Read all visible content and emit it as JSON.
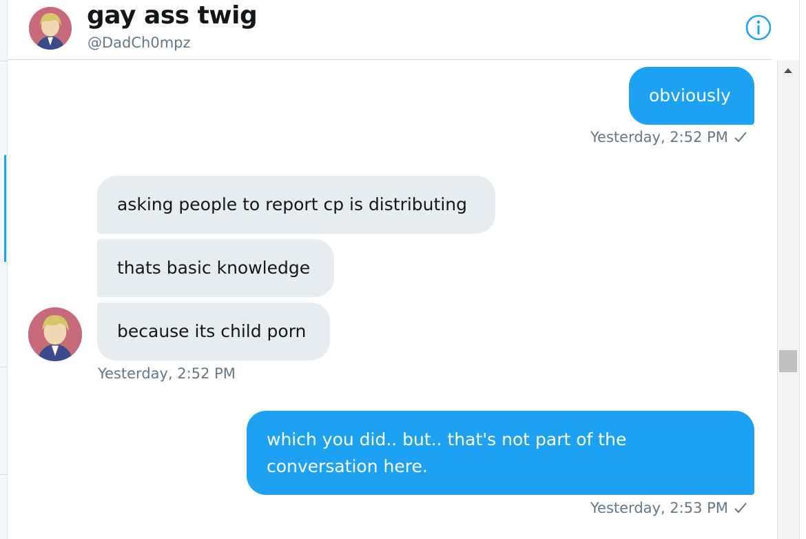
{
  "conversation": {
    "display_name": "gay ass twig",
    "handle": "@DadCh0mpz"
  },
  "icons": {
    "info": "info-circle-icon",
    "read_receipt": "checkmark-icon",
    "scroll_up": "scroll-up-arrow-icon"
  },
  "colors": {
    "accent": "#1da1f2",
    "received_bubble": "#e6ecf0",
    "meta_text": "#657786"
  },
  "messages": [
    {
      "direction": "sent",
      "text": "obviously"
    },
    {
      "meta": "Yesterday, 2:52 PM",
      "receipt": "✓"
    },
    {
      "direction": "received",
      "text": "asking people to report cp is distributing"
    },
    {
      "direction": "received",
      "text": "thats basic knowledge"
    },
    {
      "direction": "received",
      "text": "because its child porn"
    },
    {
      "meta": "Yesterday, 2:52 PM"
    },
    {
      "direction": "sent",
      "text_lines": [
        "which you did.. but.. that's not part of the",
        "conversation here."
      ]
    },
    {
      "meta": "Yesterday, 2:53 PM",
      "receipt": "✓"
    }
  ]
}
